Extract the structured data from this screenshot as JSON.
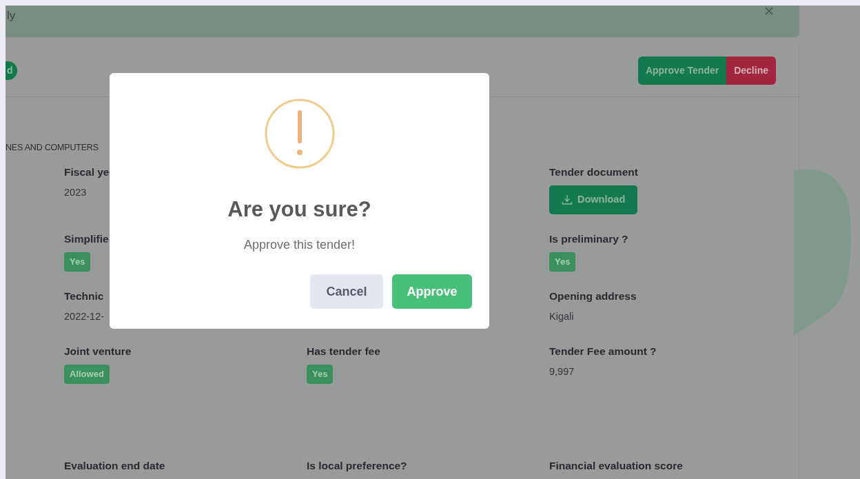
{
  "alert": {
    "text": "ly"
  },
  "header": {
    "status_badge": "d",
    "actions": [
      {
        "label": "Approve Tender",
        "kind": "approve"
      },
      {
        "label": "Decline",
        "kind": "decline"
      }
    ]
  },
  "category": "NES AND COMPUTERS",
  "rows": [
    [
      {
        "label": "Fiscal ye",
        "value": "2023",
        "kind": "text"
      },
      null,
      {
        "label": "Tender document",
        "value": "Download",
        "kind": "download"
      }
    ],
    [
      {
        "label": "Simplifie",
        "value": "Yes",
        "kind": "badge"
      },
      null,
      {
        "label": "Is preliminary ?",
        "value": "Yes",
        "kind": "badge"
      }
    ],
    [
      {
        "label": "Technic",
        "value": "2022-12-",
        "kind": "text"
      },
      null,
      {
        "label": "Opening address",
        "value": "Kigali",
        "kind": "text"
      }
    ],
    [
      {
        "label": "Joint venture",
        "value": "Allowed",
        "kind": "badge"
      },
      {
        "label": "Has tender fee",
        "value": "Yes",
        "kind": "badge"
      },
      {
        "label": "Tender Fee amount ?",
        "value": "9,997",
        "kind": "text"
      }
    ],
    [
      {
        "label": "Evaluation end date"
      },
      {
        "label": "Is local preference?"
      },
      {
        "label": "Financial evaluation score"
      }
    ]
  ],
  "modal": {
    "title": "Are you sure?",
    "text": "Approve this tender!",
    "buttons": [
      {
        "label": "Cancel",
        "kind": "cancel"
      },
      {
        "label": "Approve",
        "kind": "confirm"
      }
    ]
  }
}
